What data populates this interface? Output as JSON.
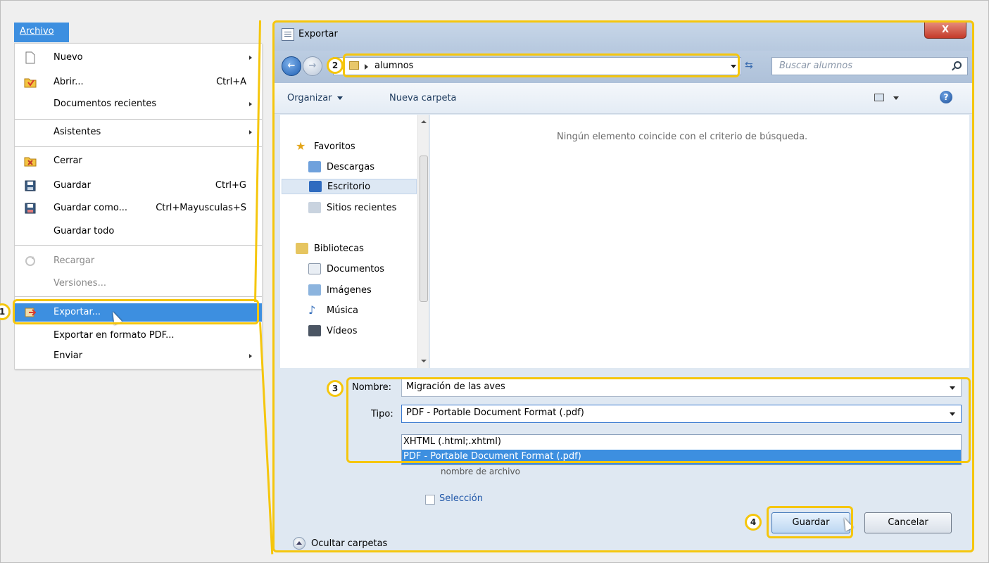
{
  "menu": {
    "title": "Archivo",
    "items": [
      {
        "label": "Nuevo",
        "shortcut": "",
        "submenu": true
      },
      {
        "label": "Abrir...",
        "shortcut": "Ctrl+A",
        "submenu": false
      },
      {
        "label": "Documentos recientes",
        "shortcut": "",
        "submenu": true
      },
      {
        "label": "Asistentes",
        "shortcut": "",
        "submenu": true
      },
      {
        "label": "Cerrar",
        "shortcut": "",
        "submenu": false
      },
      {
        "label": "Guardar",
        "shortcut": "Ctrl+G",
        "submenu": false
      },
      {
        "label": "Guardar como...",
        "shortcut": "Ctrl+Mayusculas+S",
        "submenu": false
      },
      {
        "label": "Guardar todo",
        "shortcut": "",
        "submenu": false
      },
      {
        "label": "Recargar",
        "shortcut": "",
        "submenu": false
      },
      {
        "label": "Versiones...",
        "shortcut": "",
        "submenu": false
      },
      {
        "label": "Exportar...",
        "shortcut": "",
        "submenu": false
      },
      {
        "label": "Exportar en formato PDF...",
        "shortcut": "",
        "submenu": false
      },
      {
        "label": "Enviar",
        "shortcut": "",
        "submenu": true
      }
    ]
  },
  "dialog": {
    "title": "Exportar",
    "close": "X",
    "address_path": "alumnos",
    "search_placeholder": "Buscar alumnos",
    "toolbar": {
      "organize": "Organizar",
      "new_folder": "Nueva carpeta"
    },
    "nav": {
      "favorites": "Favoritos",
      "downloads": "Descargas",
      "desktop": "Escritorio",
      "recent": "Sitios recientes",
      "libraries": "Bibliotecas",
      "documents": "Documentos",
      "images": "Imágenes",
      "music": "Música",
      "videos": "Vídeos"
    },
    "empty_message": "Ningún elemento coincide con el criterio de búsqueda.",
    "filename_label": "Nombre:",
    "filename_value": "Migración de las aves",
    "type_label": "Tipo:",
    "type_value": "PDF - Portable Document Format (.pdf)",
    "type_options": [
      "XHTML (.html;.xhtml)",
      "PDF - Portable Document Format (.pdf)"
    ],
    "hidden_behind": "nombre de archivo",
    "selection_label": "Selección",
    "hide_folders": "Ocultar carpetas",
    "save": "Guardar",
    "cancel": "Cancelar"
  },
  "callouts": [
    "1",
    "2",
    "3",
    "4"
  ],
  "colors": {
    "highlight": "#f5c60d",
    "selection": "#3d8fe0"
  }
}
